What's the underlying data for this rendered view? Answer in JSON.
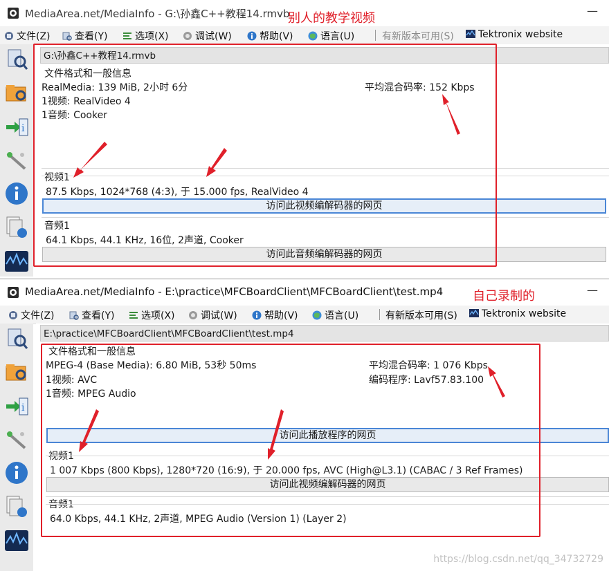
{
  "window1": {
    "title": "MediaArea.net/MediaInfo - G:\\孙鑫C++教程14.rmvb",
    "annotation": "别人的教学视频",
    "menu": [
      {
        "label": "文件(Z)",
        "icon": "file-icon"
      },
      {
        "label": "查看(Y)",
        "icon": "view-icon"
      },
      {
        "label": "选项(X)",
        "icon": "options-icon"
      },
      {
        "label": "调试(W)",
        "icon": "debug-icon"
      },
      {
        "label": "帮助(V)",
        "icon": "help-icon"
      },
      {
        "label": "语言(U)",
        "icon": "language-icon"
      }
    ],
    "new_version": "有新版本可用(S)",
    "tektronix": "Tektronix website",
    "path": "G:\\孙鑫C++教程14.rmvb",
    "general": {
      "heading": "文件格式和一般信息",
      "line1": "RealMedia: 139 MiB, 2小时 6分",
      "line2": "1视频: RealVideo 4",
      "line3": "1音频: Cooker",
      "bitrate": "平均混合码率: 152 Kbps"
    },
    "video": {
      "heading": "视频1",
      "line": "87.5 Kbps, 1024*768 (4:3), 于 15.000 fps, RealVideo 4",
      "button": "访问此视频编解码器的网页"
    },
    "audio": {
      "heading": "音频1",
      "line": "64.1 Kbps, 44.1 KHz, 16位, 2声道, Cooker",
      "button": "访问此音频编解码器的网页"
    }
  },
  "window2": {
    "title": "MediaArea.net/MediaInfo - E:\\practice\\MFCBoardClient\\MFCBoardClient\\test.mp4",
    "annotation": "自己录制的",
    "menu": [
      {
        "label": "文件(Z)",
        "icon": "file-icon"
      },
      {
        "label": "查看(Y)",
        "icon": "view-icon"
      },
      {
        "label": "选项(X)",
        "icon": "options-icon"
      },
      {
        "label": "调试(W)",
        "icon": "debug-icon"
      },
      {
        "label": "帮助(V)",
        "icon": "help-icon"
      },
      {
        "label": "语言(U)",
        "icon": "language-icon"
      }
    ],
    "new_version": "有新版本可用(S)",
    "tektronix": "Tektronix website",
    "path": "E:\\practice\\MFCBoardClient\\MFCBoardClient\\test.mp4",
    "general": {
      "heading": "文件格式和一般信息",
      "line1": "MPEG-4 (Base Media): 6.80 MiB, 53秒 50ms",
      "line2": "1视频: AVC",
      "line3": "1音频: MPEG Audio",
      "bitrate": "平均混合码率: 1 076 Kbps",
      "encoder": "编码程序: Lavf57.83.100",
      "button": "访问此播放程序的网页"
    },
    "video": {
      "heading": "视频1",
      "line": "1 007 Kbps (800 Kbps), 1280*720 (16:9), 于 20.000 fps, AVC (High@L3.1) (CABAC / 3 Ref Frames)",
      "button": "访问此视频编解码器的网页"
    },
    "audio": {
      "heading": "音频1",
      "line": "64.0 Kbps, 44.1 KHz, 2声道, MPEG Audio (Version 1) (Layer 2)"
    }
  },
  "watermark": "https://blog.csdn.net/qq_34732729",
  "colors": {
    "annotation_red": "#e0202a",
    "focus_blue": "#4a86d6"
  }
}
